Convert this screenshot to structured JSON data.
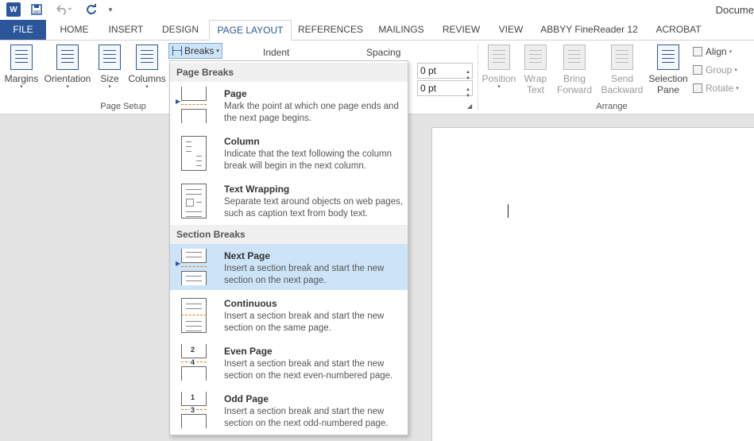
{
  "qat": {
    "app_icon": "word-icon",
    "app_letter": "W",
    "save_icon": "save-icon",
    "undo_icon": "undo-icon",
    "redo_icon": "redo-icon",
    "customize_icon": "chevron-down-icon"
  },
  "title": "Docume",
  "tabs": [
    {
      "label": "FILE"
    },
    {
      "label": "HOME"
    },
    {
      "label": "INSERT"
    },
    {
      "label": "DESIGN"
    },
    {
      "label": "PAGE LAYOUT"
    },
    {
      "label": "REFERENCES"
    },
    {
      "label": "MAILINGS"
    },
    {
      "label": "REVIEW"
    },
    {
      "label": "VIEW"
    },
    {
      "label": "ABBYY FineReader 12"
    },
    {
      "label": "ACROBAT"
    }
  ],
  "active_tab": "PAGE LAYOUT",
  "ribbon": {
    "page_setup": {
      "margins": "Margins",
      "orientation": "Orientation",
      "size": "Size",
      "columns": "Columns",
      "breaks": "Breaks",
      "group_label": "Page Setup"
    },
    "paragraph": {
      "indent_label": "Indent",
      "spacing_label": "Spacing",
      "before_value": "0 pt",
      "after_value": "0 pt"
    },
    "arrange": {
      "position": "Position",
      "wrap_text_1": "Wrap",
      "wrap_text_2": "Text",
      "bring_forward_1": "Bring",
      "bring_forward_2": "Forward",
      "send_backward_1": "Send",
      "send_backward_2": "Backward",
      "selection_pane_1": "Selection",
      "selection_pane_2": "Pane",
      "align": "Align",
      "group": "Group",
      "rotate": "Rotate",
      "group_label": "Arrange"
    }
  },
  "breaks_menu": {
    "page_breaks_header": "Page Breaks",
    "section_breaks_header": "Section Breaks",
    "items": [
      {
        "title": "Page",
        "desc": "Mark the point at which one page ends and the next page begins."
      },
      {
        "title": "Column",
        "desc": "Indicate that the text following the column break will begin in the next column."
      },
      {
        "title": "Text Wrapping",
        "desc": "Separate text around objects on web pages, such as caption text from body text."
      },
      {
        "title": "Next Page",
        "desc": "Insert a section break and start the new section on the next page."
      },
      {
        "title": "Continuous",
        "desc": "Insert a section break and start the new section on the same page."
      },
      {
        "title": "Even Page",
        "desc": "Insert a section break and start the new section on the next even-numbered page."
      },
      {
        "title": "Odd Page",
        "desc": "Insert a section break and start the new section on the next odd-numbered page."
      }
    ],
    "even_nums": [
      "2",
      "4"
    ],
    "odd_nums": [
      "1",
      "3"
    ]
  },
  "colors": {
    "accent": "#2b579a",
    "highlight": "#cde3f7",
    "break_line": "#e07a1f"
  }
}
